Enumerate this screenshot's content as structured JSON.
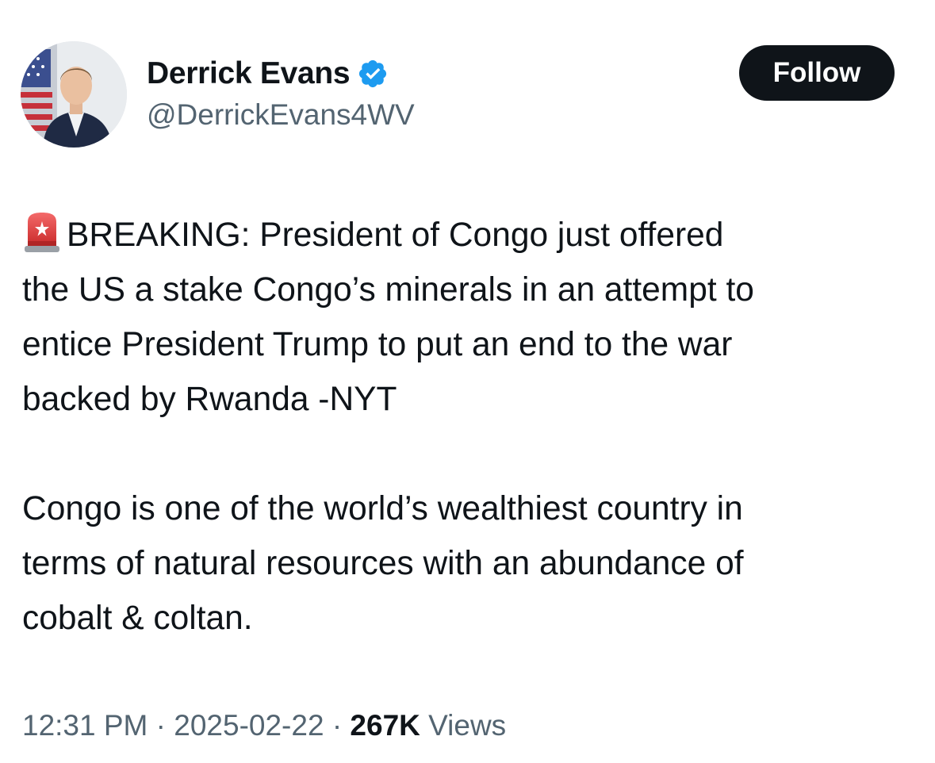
{
  "author": {
    "display_name": "Derrick Evans",
    "handle": "@DerrickEvans4WV",
    "verified": true,
    "avatar_icon": "profile-photo"
  },
  "follow_button": {
    "label": "Follow"
  },
  "tweet": {
    "leading_emoji": "police-car-light-icon",
    "paragraph_1": "BREAKING: President of Congo just offered\nthe US a stake Congo’s minerals in an attempt to\nentice President Trump to put an end to the war\nbacked by Rwanda -NYT",
    "paragraph_2": "Congo is one of the world’s wealthiest country in\nterms of natural resources with an abundance of\ncobalt & coltan."
  },
  "meta": {
    "time": "12:31 PM",
    "separator": "·",
    "date": "2025-02-22",
    "views_count": "267K",
    "views_label": "Views"
  },
  "colors": {
    "text_primary": "#0f1419",
    "text_secondary": "#536471",
    "verified_blue": "#1d9bf0",
    "button_bg": "#0f1419",
    "button_text": "#ffffff",
    "background": "#ffffff"
  }
}
